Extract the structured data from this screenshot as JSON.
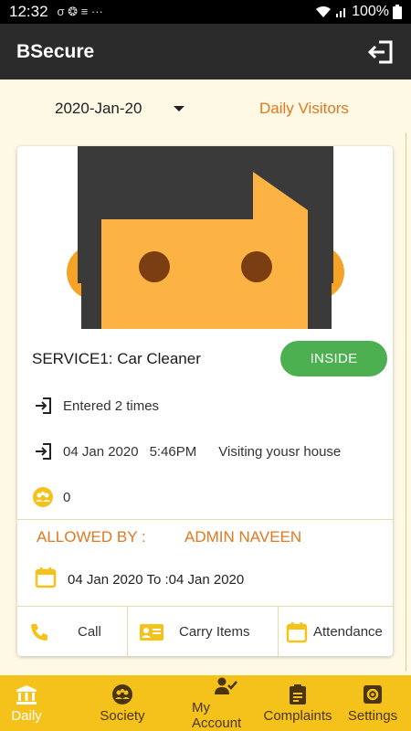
{
  "status_bar": {
    "time": "12:32",
    "notifications": "σ ❂ ≡ ···",
    "battery": "100%"
  },
  "app_bar": {
    "title": "BSecure",
    "logout_icon": "logout-icon"
  },
  "filter": {
    "date": "2020-Jan-20",
    "page_label": "Daily Visitors"
  },
  "visitor": {
    "name": "SERVICE1: Car Cleaner",
    "status": "INSIDE",
    "status_color": "#4caf50",
    "entries": "Entered 2 times",
    "entry_date": "04 Jan 2020",
    "entry_time": "5:46PM",
    "purpose": "Visiting  yousr house",
    "group_count": "0",
    "allowed_by_label": "ALLOWED BY :",
    "allowed_by_name": "ADMIN NAVEEN",
    "validity": "04 Jan 2020 To :04 Jan 2020"
  },
  "actions": [
    {
      "label": "Call",
      "icon": "phone-icon"
    },
    {
      "label": "Carry Items",
      "icon": "id-card-icon"
    },
    {
      "label": "Attendance",
      "icon": "calendar-icon"
    }
  ],
  "bottom_nav": [
    {
      "label": "Daily",
      "icon": "bank-icon",
      "active": true
    },
    {
      "label": "Society",
      "icon": "group-icon",
      "active": false
    },
    {
      "label": "My Account",
      "icon": "user-check-icon",
      "active": false
    },
    {
      "label": "Complaints",
      "icon": "clipboard-icon",
      "active": false
    },
    {
      "label": "Settings",
      "icon": "gear-icon",
      "active": false
    }
  ],
  "colors": {
    "accent": "#e0781f",
    "nav_bg": "#f5c21b",
    "icon_yellow": "#f5c21b",
    "app_bar": "#2b2b2b",
    "page_bg": "#fdf9e4"
  }
}
